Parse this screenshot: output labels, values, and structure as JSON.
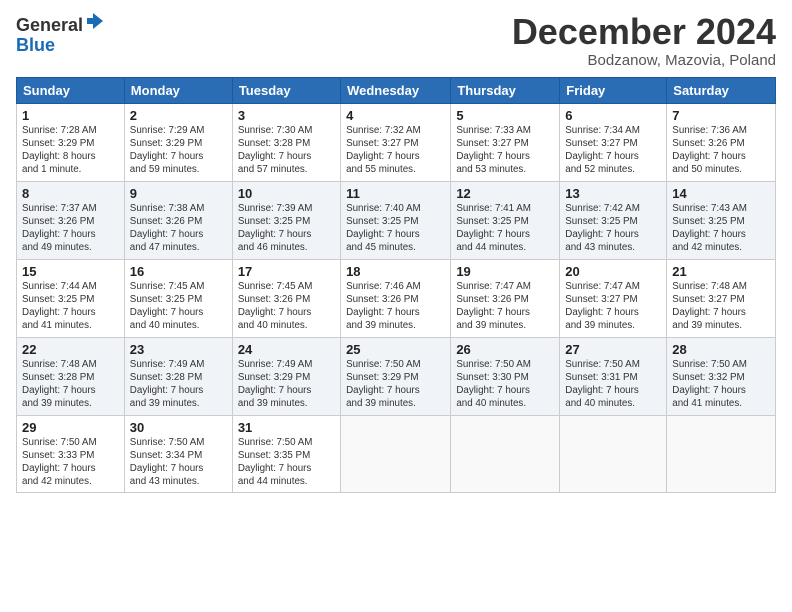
{
  "header": {
    "logo": {
      "line1": "General",
      "line2": "Blue"
    },
    "month_title": "December 2024",
    "location": "Bodzanow, Mazovia, Poland"
  },
  "weekdays": [
    "Sunday",
    "Monday",
    "Tuesday",
    "Wednesday",
    "Thursday",
    "Friday",
    "Saturday"
  ],
  "weeks": [
    [
      {
        "day": 1,
        "sunrise": "7:28 AM",
        "sunset": "3:29 PM",
        "daylight": "8 hours and 1 minute."
      },
      {
        "day": 2,
        "sunrise": "7:29 AM",
        "sunset": "3:29 PM",
        "daylight": "7 hours and 59 minutes."
      },
      {
        "day": 3,
        "sunrise": "7:30 AM",
        "sunset": "3:28 PM",
        "daylight": "7 hours and 57 minutes."
      },
      {
        "day": 4,
        "sunrise": "7:32 AM",
        "sunset": "3:27 PM",
        "daylight": "7 hours and 55 minutes."
      },
      {
        "day": 5,
        "sunrise": "7:33 AM",
        "sunset": "3:27 PM",
        "daylight": "7 hours and 53 minutes."
      },
      {
        "day": 6,
        "sunrise": "7:34 AM",
        "sunset": "3:27 PM",
        "daylight": "7 hours and 52 minutes."
      },
      {
        "day": 7,
        "sunrise": "7:36 AM",
        "sunset": "3:26 PM",
        "daylight": "7 hours and 50 minutes."
      }
    ],
    [
      {
        "day": 8,
        "sunrise": "7:37 AM",
        "sunset": "3:26 PM",
        "daylight": "7 hours and 49 minutes."
      },
      {
        "day": 9,
        "sunrise": "7:38 AM",
        "sunset": "3:26 PM",
        "daylight": "7 hours and 47 minutes."
      },
      {
        "day": 10,
        "sunrise": "7:39 AM",
        "sunset": "3:25 PM",
        "daylight": "7 hours and 46 minutes."
      },
      {
        "day": 11,
        "sunrise": "7:40 AM",
        "sunset": "3:25 PM",
        "daylight": "7 hours and 45 minutes."
      },
      {
        "day": 12,
        "sunrise": "7:41 AM",
        "sunset": "3:25 PM",
        "daylight": "7 hours and 44 minutes."
      },
      {
        "day": 13,
        "sunrise": "7:42 AM",
        "sunset": "3:25 PM",
        "daylight": "7 hours and 43 minutes."
      },
      {
        "day": 14,
        "sunrise": "7:43 AM",
        "sunset": "3:25 PM",
        "daylight": "7 hours and 42 minutes."
      }
    ],
    [
      {
        "day": 15,
        "sunrise": "7:44 AM",
        "sunset": "3:25 PM",
        "daylight": "7 hours and 41 minutes."
      },
      {
        "day": 16,
        "sunrise": "7:45 AM",
        "sunset": "3:25 PM",
        "daylight": "7 hours and 40 minutes."
      },
      {
        "day": 17,
        "sunrise": "7:45 AM",
        "sunset": "3:26 PM",
        "daylight": "7 hours and 40 minutes."
      },
      {
        "day": 18,
        "sunrise": "7:46 AM",
        "sunset": "3:26 PM",
        "daylight": "7 hours and 39 minutes."
      },
      {
        "day": 19,
        "sunrise": "7:47 AM",
        "sunset": "3:26 PM",
        "daylight": "7 hours and 39 minutes."
      },
      {
        "day": 20,
        "sunrise": "7:47 AM",
        "sunset": "3:27 PM",
        "daylight": "7 hours and 39 minutes."
      },
      {
        "day": 21,
        "sunrise": "7:48 AM",
        "sunset": "3:27 PM",
        "daylight": "7 hours and 39 minutes."
      }
    ],
    [
      {
        "day": 22,
        "sunrise": "7:48 AM",
        "sunset": "3:28 PM",
        "daylight": "7 hours and 39 minutes."
      },
      {
        "day": 23,
        "sunrise": "7:49 AM",
        "sunset": "3:28 PM",
        "daylight": "7 hours and 39 minutes."
      },
      {
        "day": 24,
        "sunrise": "7:49 AM",
        "sunset": "3:29 PM",
        "daylight": "7 hours and 39 minutes."
      },
      {
        "day": 25,
        "sunrise": "7:50 AM",
        "sunset": "3:29 PM",
        "daylight": "7 hours and 39 minutes."
      },
      {
        "day": 26,
        "sunrise": "7:50 AM",
        "sunset": "3:30 PM",
        "daylight": "7 hours and 40 minutes."
      },
      {
        "day": 27,
        "sunrise": "7:50 AM",
        "sunset": "3:31 PM",
        "daylight": "7 hours and 40 minutes."
      },
      {
        "day": 28,
        "sunrise": "7:50 AM",
        "sunset": "3:32 PM",
        "daylight": "7 hours and 41 minutes."
      }
    ],
    [
      {
        "day": 29,
        "sunrise": "7:50 AM",
        "sunset": "3:33 PM",
        "daylight": "7 hours and 42 minutes."
      },
      {
        "day": 30,
        "sunrise": "7:50 AM",
        "sunset": "3:34 PM",
        "daylight": "7 hours and 43 minutes."
      },
      {
        "day": 31,
        "sunrise": "7:50 AM",
        "sunset": "3:35 PM",
        "daylight": "7 hours and 44 minutes."
      },
      null,
      null,
      null,
      null
    ]
  ]
}
